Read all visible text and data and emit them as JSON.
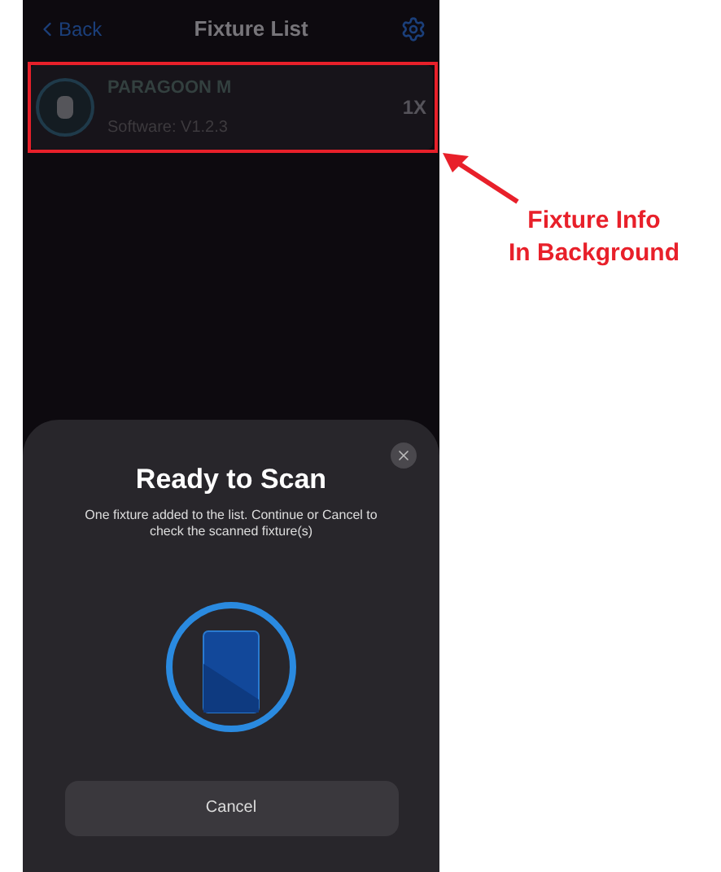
{
  "nav": {
    "back": "Back",
    "title": "Fixture List"
  },
  "fixture": {
    "name": "PARAGOON M",
    "software": "Software: V1.2.3",
    "count": "1X"
  },
  "annotation": {
    "line1": "Fixture Info",
    "line2": "In Background"
  },
  "sheet": {
    "title": "Ready to Scan",
    "message": "One fixture added to the list. Continue or Cancel to check the scanned fixture(s)",
    "button": "Cancel"
  }
}
